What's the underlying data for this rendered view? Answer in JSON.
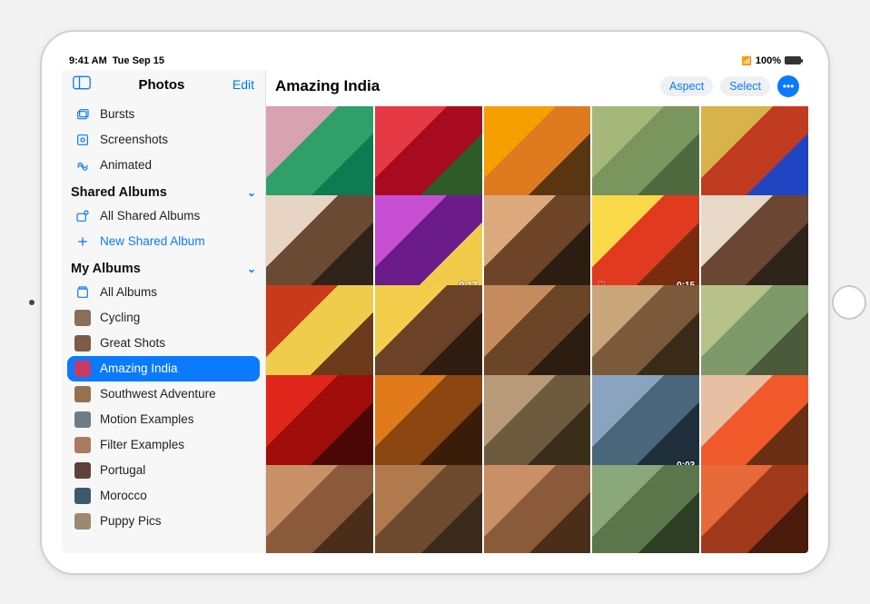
{
  "status": {
    "time": "9:41 AM",
    "date": "Tue Sep 15",
    "battery": "100%"
  },
  "sidebar": {
    "title": "Photos",
    "edit": "Edit",
    "mediaTypes": [
      {
        "label": "Bursts",
        "icon": "bursts"
      },
      {
        "label": "Screenshots",
        "icon": "screenshots"
      },
      {
        "label": "Animated",
        "icon": "animated"
      }
    ],
    "sharedSection": "Shared Albums",
    "sharedItems": [
      {
        "label": "All Shared Albums",
        "icon": "shared"
      },
      {
        "label": "New Shared Album",
        "icon": "plus",
        "action": true
      }
    ],
    "mySection": "My Albums",
    "myItems": [
      {
        "label": "All Albums",
        "icon": "albums",
        "thumb": null
      },
      {
        "label": "Cycling",
        "thumb": "#8a6e5a"
      },
      {
        "label": "Great Shots",
        "thumb": "#7c5c46"
      },
      {
        "label": "Amazing India",
        "thumb": "#c73b63",
        "selected": true
      },
      {
        "label": "Southwest Adventure",
        "thumb": "#97704e"
      },
      {
        "label": "Motion Examples",
        "thumb": "#6d7c87"
      },
      {
        "label": "Filter Examples",
        "thumb": "#a97c5f"
      },
      {
        "label": "Portugal",
        "thumb": "#5e4239"
      },
      {
        "label": "Morocco",
        "thumb": "#3b5a6e"
      },
      {
        "label": "Puppy Pics",
        "thumb": "#9c8a6f"
      }
    ]
  },
  "main": {
    "title": "Amazing India",
    "actions": {
      "aspect": "Aspect",
      "select": "Select"
    },
    "photos": [
      {
        "colors": [
          "#d7a2b2",
          "#2fa06a",
          "#0e7b53"
        ],
        "badge": null
      },
      {
        "colors": [
          "#e63946",
          "#a80b1f",
          "#2f5a2a"
        ],
        "badge": null
      },
      {
        "colors": [
          "#f59f00",
          "#e07a1f",
          "#5a3512"
        ],
        "badge": null
      },
      {
        "colors": [
          "#a5b87a",
          "#7a955e",
          "#4e6a3e"
        ],
        "badge": null
      },
      {
        "colors": [
          "#d8b24a",
          "#c03b1f",
          "#2044c2"
        ],
        "badge": null
      },
      {
        "colors": [
          "#e8d4c4",
          "#6b4a33",
          "#2f2419"
        ],
        "badge": null
      },
      {
        "colors": [
          "#c74fd4",
          "#6b1c8a",
          "#f0cc4a"
        ],
        "badge": "0:17"
      },
      {
        "colors": [
          "#dba97b",
          "#6e4428",
          "#2d1d10"
        ],
        "badge": null
      },
      {
        "colors": [
          "#f9d84a",
          "#e03a1f",
          "#7a2c0e"
        ],
        "badge": "0:15",
        "fav": true
      },
      {
        "colors": [
          "#e8d8c8",
          "#6b4633",
          "#2f2419"
        ],
        "badge": null
      },
      {
        "colors": [
          "#c93a1a",
          "#f0cc4c",
          "#6b3a1a"
        ],
        "badge": null
      },
      {
        "colors": [
          "#f2cc4a",
          "#6b4228",
          "#2e1d10"
        ],
        "badge": null
      },
      {
        "colors": [
          "#c58a5e",
          "#6b4528",
          "#2d1d10"
        ],
        "badge": null
      },
      {
        "colors": [
          "#c9a67a",
          "#7a5a3a",
          "#3a2a18"
        ],
        "badge": null
      },
      {
        "colors": [
          "#b7c28a",
          "#7e9a6a",
          "#4a5a3a"
        ],
        "badge": null
      },
      {
        "colors": [
          "#e0261a",
          "#a00c0a",
          "#4a0705"
        ],
        "badge": null
      },
      {
        "colors": [
          "#e07a1a",
          "#8a4510",
          "#3a1d08"
        ],
        "badge": null
      },
      {
        "colors": [
          "#b89a78",
          "#6e5a3e",
          "#3a2e1a"
        ],
        "badge": null
      },
      {
        "colors": [
          "#8aa4c0",
          "#4a667a",
          "#1e2e3a"
        ],
        "badge": "0:03"
      },
      {
        "colors": [
          "#e8bfa2",
          "#f05a2a",
          "#6a2e14"
        ],
        "badge": null
      },
      {
        "colors": [
          "#c99068",
          "#8a5a3a",
          "#4a2e1a"
        ],
        "badge": null
      },
      {
        "colors": [
          "#b07a4e",
          "#6e4a2e",
          "#3a2a1a"
        ],
        "badge": null
      },
      {
        "colors": [
          "#c99068",
          "#8a5a3a",
          "#4a2e1a"
        ],
        "badge": null
      },
      {
        "colors": [
          "#8aa87a",
          "#5a764a",
          "#2e3e24"
        ],
        "badge": null
      },
      {
        "colors": [
          "#e86a3a",
          "#a03a1a",
          "#4a1a0a"
        ],
        "badge": null
      }
    ]
  }
}
